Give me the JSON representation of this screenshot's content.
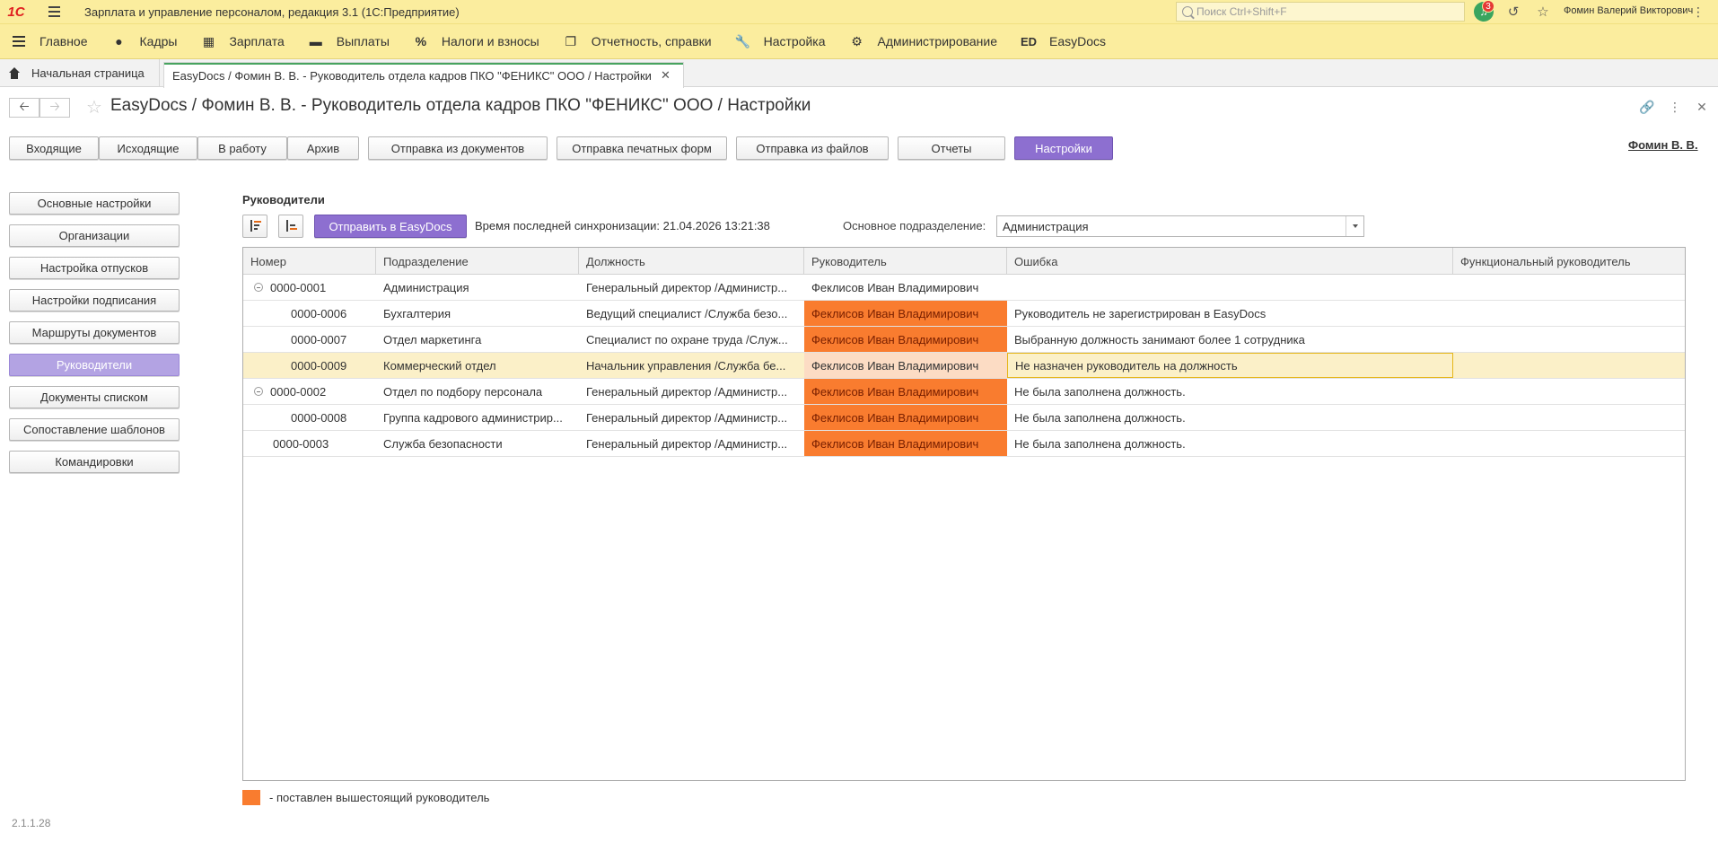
{
  "app": {
    "logo": "1С",
    "title": "Зарплата и управление персоналом, редакция 3.1  (1С:Предприятие)",
    "search_placeholder": "Поиск Ctrl+Shift+F",
    "notifications_count": "3",
    "user": "Фомин Валерий Викторович"
  },
  "sections": [
    {
      "label": "Главное",
      "icon": "menu-icon"
    },
    {
      "label": "Кадры",
      "icon": "people-icon"
    },
    {
      "label": "Зарплата",
      "icon": "calculator-icon"
    },
    {
      "label": "Выплаты",
      "icon": "wallet-icon"
    },
    {
      "label": "Налоги и взносы",
      "icon": "percent-icon"
    },
    {
      "label": "Отчетность, справки",
      "icon": "reports-icon"
    },
    {
      "label": "Настройка",
      "icon": "wrench-icon"
    },
    {
      "label": "Администрирование",
      "icon": "gear-icon"
    },
    {
      "label": "EasyDocs",
      "icon": "easydocs-icon",
      "glyph": "ED"
    }
  ],
  "tabs": {
    "home": "Начальная страница",
    "active": "EasyDocs / Фомин В. В. - Руководитель отдела кадров ПКО \"ФЕНИКС\" ООО / Настройки"
  },
  "form": {
    "title": "EasyDocs / Фомин В. В. - Руководитель отдела кадров ПКО \"ФЕНИКС\" ООО / Настройки",
    "user_link": "Фомин В. В."
  },
  "top_buttons": [
    "Входящие",
    "Исходящие",
    "В работу",
    "Архив",
    "Отправка из документов",
    "Отправка печатных форм",
    "Отправка из файлов",
    "Отчеты",
    "Настройки"
  ],
  "left_nav": [
    "Основные настройки",
    "Организации",
    "Настройка отпусков",
    "Настройки подписания",
    "Маршруты документов",
    "Руководители",
    "Документы списком",
    "Сопоставление шаблонов",
    "Командировки"
  ],
  "content": {
    "section_title": "Руководители",
    "send_button": "Отправить в EasyDocs",
    "sync_text": "Время последней синхронизации: 21.04.2026 13:21:38",
    "dept_label": "Основное подразделение:",
    "dept_value": "Администрация"
  },
  "table": {
    "columns": [
      "Номер",
      "Подразделение",
      "Должность",
      "Руководитель",
      "Ошибка",
      "Функциональный руководитель"
    ],
    "rows": [
      {
        "number": "0000-0001",
        "dept": "Администрация",
        "position": "Генеральный директор /Администр...",
        "manager": "Феклисов Иван Владимирович",
        "error": "",
        "functional": ""
      },
      {
        "number": "0000-0006",
        "dept": "Бухгалтерия",
        "position": "Ведущий специалист /Служба безо...",
        "manager": "Феклисов Иван Владимирович",
        "error": "Руководитель не зарегистрирован в EasyDocs",
        "functional": ""
      },
      {
        "number": "0000-0007",
        "dept": "Отдел маркетинга",
        "position": "Специалист по охране труда /Служ...",
        "manager": "Феклисов Иван Владимирович",
        "error": "Выбранную должность занимают более 1 сотрудника",
        "functional": ""
      },
      {
        "number": "0000-0009",
        "dept": "Коммерческий отдел",
        "position": "Начальник управления /Служба бе...",
        "manager": "Феклисов Иван Владимирович",
        "error": "Не назначен руководитель на должность",
        "functional": ""
      },
      {
        "number": "0000-0002",
        "dept": "Отдел по подбору персонала",
        "position": "Генеральный директор /Администр...",
        "manager": "Феклисов Иван Владимирович",
        "error": "Не была заполнена должность.",
        "functional": ""
      },
      {
        "number": "0000-0008",
        "dept": "Группа кадрового администрир...",
        "position": "Генеральный директор /Администр...",
        "manager": "Феклисов Иван Владимирович",
        "error": "Не была заполнена должность.",
        "functional": ""
      },
      {
        "number": "0000-0003",
        "dept": "Служба безопасности",
        "position": "Генеральный директор /Администр...",
        "manager": "Феклисов Иван Владимирович",
        "error": "Не была заполнена должность.",
        "functional": ""
      }
    ]
  },
  "legend": {
    "text": "- поставлен вышестоящий руководитель",
    "color": "#f97c2f"
  },
  "version": "2.1.1.28",
  "colors": {
    "topbar": "#fbed9e",
    "primary": "#8d6fd0",
    "active_nav": "#b3a3e3",
    "highlight": "#f97c2f",
    "selected_row": "#fbf0c8"
  }
}
